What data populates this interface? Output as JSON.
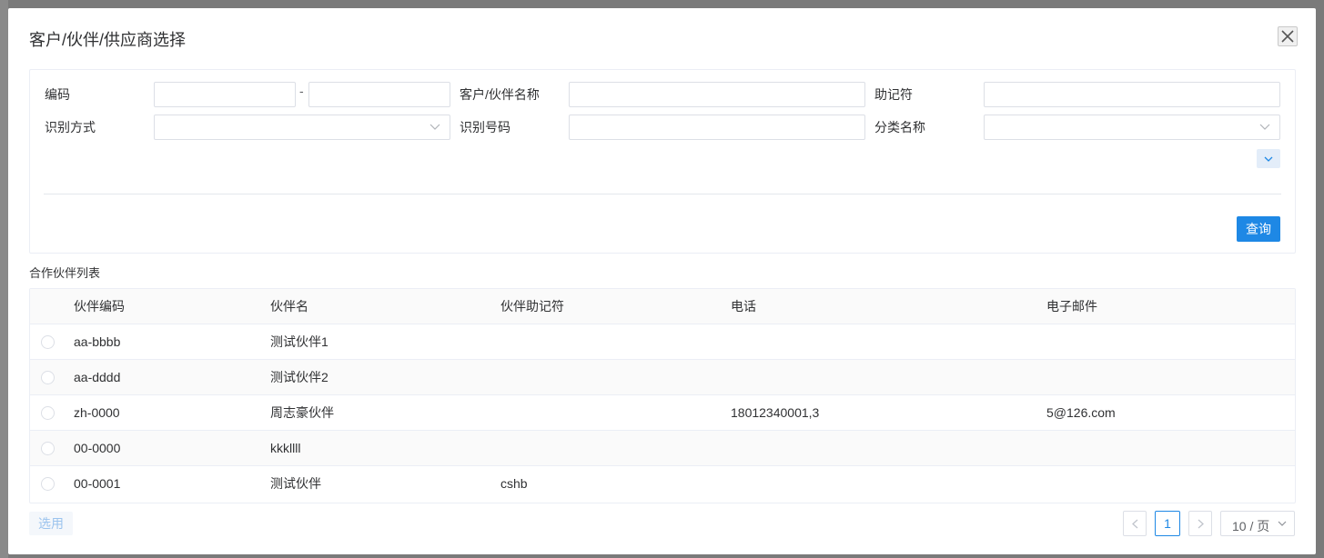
{
  "dialog": {
    "title": "客户/伙伴/供应商选择"
  },
  "search": {
    "code_label": "编码",
    "range_dash": "-",
    "name_label": "客户/伙伴名称",
    "mnemonic_label": "助记符",
    "id_method_label": "识别方式",
    "id_number_label": "识别号码",
    "category_label": "分类名称",
    "code_from": "",
    "code_to": "",
    "name_value": "",
    "mnemonic_value": "",
    "id_number_value": "",
    "query_label": "查询"
  },
  "list": {
    "title": "合作伙伴列表",
    "columns": [
      "伙伴编码",
      "伙伴名",
      "伙伴助记符",
      "电话",
      "电子邮件"
    ],
    "rows": [
      {
        "code": "aa-bbbb",
        "name": "测试伙伴1",
        "mnemonic": "",
        "phone": "",
        "email": ""
      },
      {
        "code": "aa-dddd",
        "name": "测试伙伴2",
        "mnemonic": "",
        "phone": "",
        "email": ""
      },
      {
        "code": "zh-0000",
        "name": "周志豪伙伴",
        "mnemonic": "",
        "phone": "18012340001,3",
        "email": "5@126.com"
      },
      {
        "code": "00-0000",
        "name": "kkkllll",
        "mnemonic": "",
        "phone": "",
        "email": ""
      },
      {
        "code": "00-0001",
        "name": "测试伙伴",
        "mnemonic": "cshb",
        "phone": "",
        "email": ""
      }
    ]
  },
  "footer": {
    "select_label": "选用",
    "current_page": "1",
    "page_size": "10 / 页"
  },
  "colors": {
    "primary": "#1e88e5",
    "border": "#dcdfe6"
  }
}
